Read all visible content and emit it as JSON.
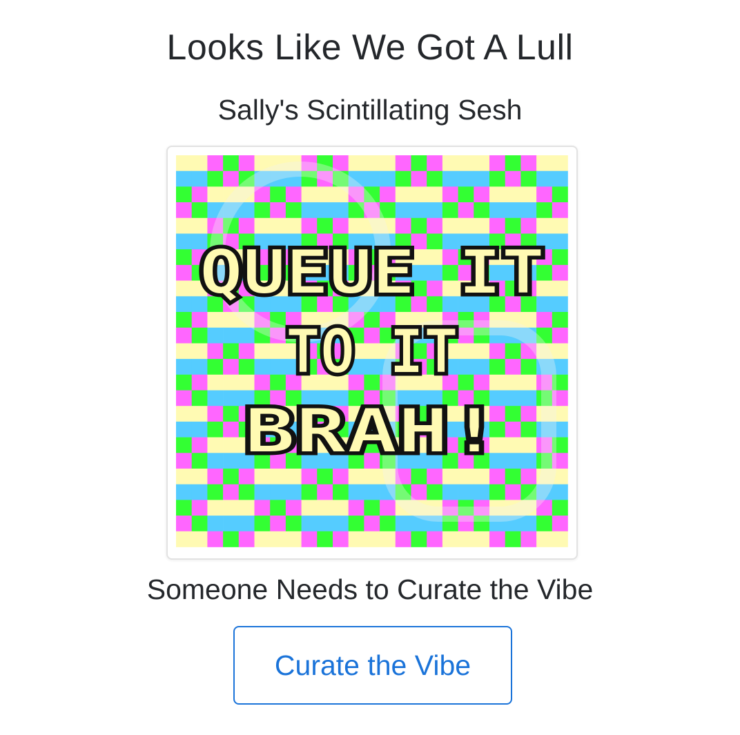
{
  "header": {
    "title": "Looks Like We Got A Lull",
    "subtitle": "Sally's Scintillating Sesh"
  },
  "artwork": {
    "lines": [
      "QUEUE IT",
      "TO IT",
      "BRAH!"
    ],
    "palette": [
      "#ff66ff",
      "#fffab3",
      "#33ff33",
      "#55ccff"
    ]
  },
  "prompt": {
    "text": "Someone Needs to Curate the Vibe"
  },
  "cta": {
    "label": "Curate the Vibe",
    "color": "#1a73d9"
  }
}
